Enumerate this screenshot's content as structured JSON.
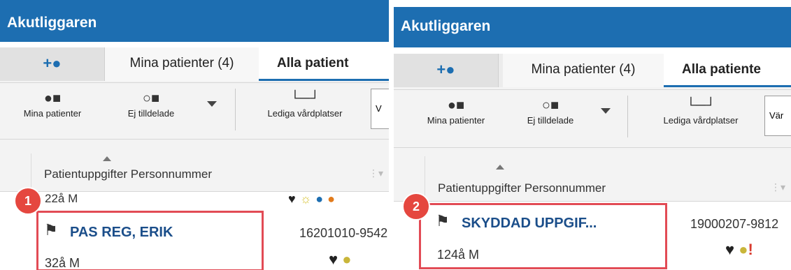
{
  "panel1": {
    "title": "Akutliggaren",
    "tabs": {
      "add_icon": "add-patient-icon",
      "mine": "Mina patienter (4)",
      "all": "Alla patient"
    },
    "toolbar": {
      "mine": "Mina patienter",
      "unassigned": "Ej tilldelade",
      "free_beds": "Lediga vårdplatser",
      "partial_button": "V"
    },
    "columns": "Patientuppgifter  Personnummer",
    "previous_row_age": "22å M",
    "previous_icons": [
      "heartbeat-icon",
      "sun-icon",
      "badge-48-icon",
      "orange-icon"
    ],
    "patient": {
      "name": "PAS REG, ERIK",
      "age": "32å M",
      "personnummer": "16201010-9542"
    },
    "badge_number": "1"
  },
  "panel2": {
    "title": "Akutliggaren",
    "tabs": {
      "add_icon": "add-patient-icon",
      "mine": "Mina patienter (4)",
      "all": "Alla patiente"
    },
    "toolbar": {
      "mine": "Mina patienter",
      "unassigned": "Ej tilldelade",
      "free_beds": "Lediga vårdplatser",
      "partial_button": "Vär"
    },
    "columns": "Patientuppgifter  Personnummer",
    "patient": {
      "name": "SKYDDAD UPPGIF...",
      "age": "124å M",
      "personnummer": "19000207-9812"
    },
    "badge_number": "2"
  },
  "colors": {
    "titlebar": "#1d6eb1",
    "patient_name": "#1b4e8a",
    "highlight": "#e24b55",
    "badge": "#e5473f"
  }
}
